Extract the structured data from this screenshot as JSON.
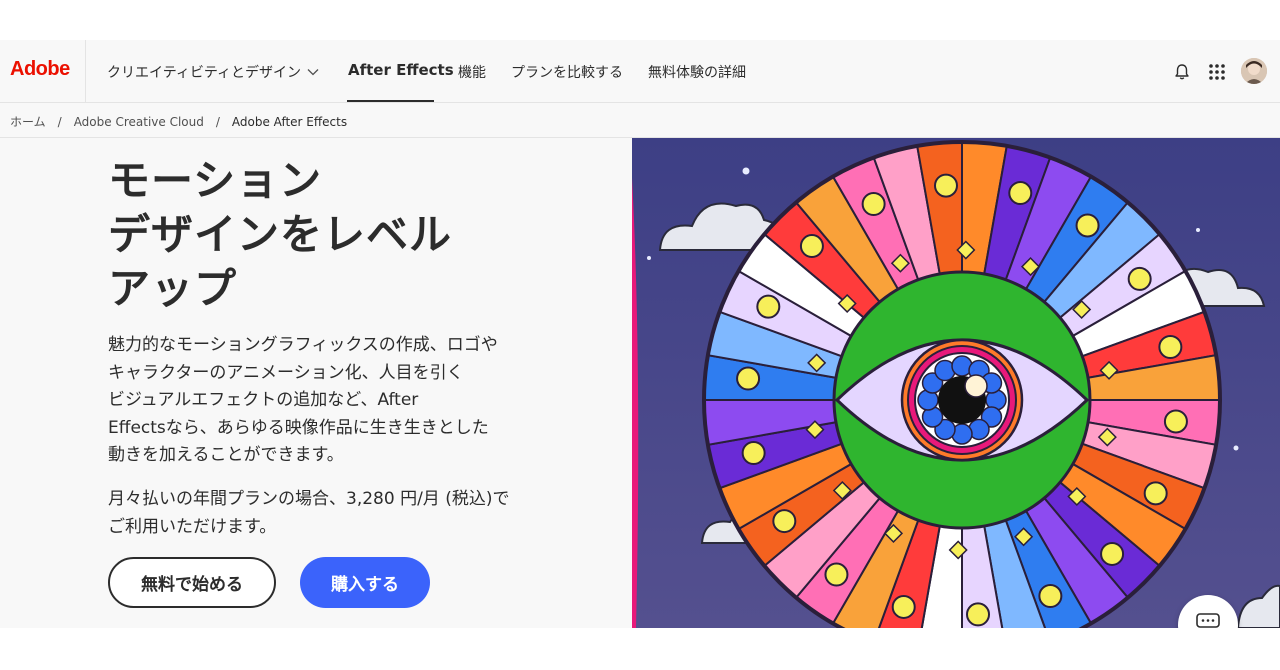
{
  "nav": {
    "logo": "Adobe",
    "creativity_menu": "クリエイティビティとデザイン",
    "active_product": "After Effects",
    "features": "機能",
    "compare_plans": "プランを比較する",
    "free_trial": "無料体験の詳細"
  },
  "breadcrumb": {
    "home": "ホーム",
    "separator": "/",
    "cloud": "Adobe Creative Cloud",
    "current": "Adobe After Effects"
  },
  "hero": {
    "title_lines": [
      "モーション",
      "デザインをレベル",
      "アップ"
    ],
    "description_lines": [
      "魅力的なモーショングラフィックスの作成、ロゴや",
      "キャラクターのアニメーション化、人目を引く",
      "ビジュアルエフェクトの追加など、After",
      "Effectsなら、あらゆる映像作品に生き生きとした",
      "動きを加えることができます。"
    ],
    "price_lines": [
      "月々払いの年間プランの場合、3,280 円/月 (税込)で",
      "ご利用いただけます。"
    ],
    "free_button": "無料で始める",
    "buy_button": "購入する"
  },
  "icons": {
    "bell": "bell-icon",
    "apps": "apps-grid-icon",
    "chevron": "chevron-down-icon",
    "chat": "chat-icon"
  },
  "colors": {
    "brand_red": "#eb1000",
    "primary_blue": "#3b63fb",
    "hero_bg": "#4a4a88"
  }
}
